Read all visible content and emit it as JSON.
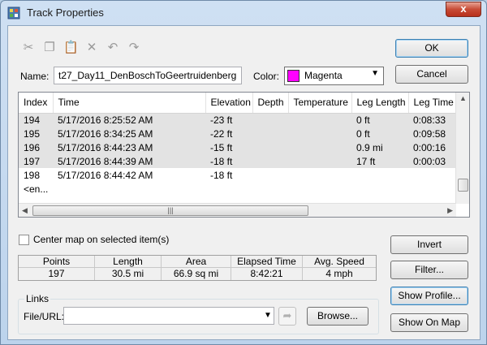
{
  "window": {
    "title": "Track Properties",
    "close_label": "x"
  },
  "toolbar": {
    "icons": [
      "cut-icon",
      "copy-icon",
      "paste-icon",
      "delete-icon",
      "undo-icon",
      "redo-icon"
    ]
  },
  "buttons": {
    "ok": "OK",
    "cancel": "Cancel",
    "invert": "Invert",
    "filter": "Filter...",
    "show_profile": "Show Profile...",
    "show_on_map": "Show On Map",
    "browse": "Browse..."
  },
  "name_field": {
    "label": "Name:",
    "value": "t27_Day11_DenBoschToGeertruidenberg"
  },
  "color_field": {
    "label": "Color:",
    "value": "Magenta",
    "swatch": "#ff00ff"
  },
  "grid": {
    "columns": [
      "Index",
      "Time",
      "Elevation",
      "Depth",
      "Temperature",
      "Leg Length",
      "Leg Time"
    ],
    "rows": [
      [
        "194",
        "5/17/2016 8:25:52 AM",
        "-23 ft",
        "",
        "",
        "0 ft",
        "0:08:33"
      ],
      [
        "195",
        "5/17/2016 8:34:25 AM",
        "-22 ft",
        "",
        "",
        "0 ft",
        "0:09:58"
      ],
      [
        "196",
        "5/17/2016 8:44:23 AM",
        "-15 ft",
        "",
        "",
        "0.9 mi",
        "0:00:16"
      ],
      [
        "197",
        "5/17/2016 8:44:39 AM",
        "-18 ft",
        "",
        "",
        "17 ft",
        "0:00:03"
      ],
      [
        "198",
        "5/17/2016 8:44:42 AM",
        "-18 ft",
        "",
        "",
        "",
        ""
      ]
    ],
    "end_row": "<en..."
  },
  "center_map": {
    "label": "Center map on selected item(s)",
    "checked": false
  },
  "stats": {
    "headers": [
      "Points",
      "Length",
      "Area",
      "Elapsed Time",
      "Avg. Speed"
    ],
    "values": [
      "197",
      "30.5 mi",
      "66.9 sq mi",
      "8:42:21",
      "4 mph"
    ]
  },
  "links": {
    "group_label": "Links",
    "file_label": "File/URL:",
    "file_value": ""
  }
}
